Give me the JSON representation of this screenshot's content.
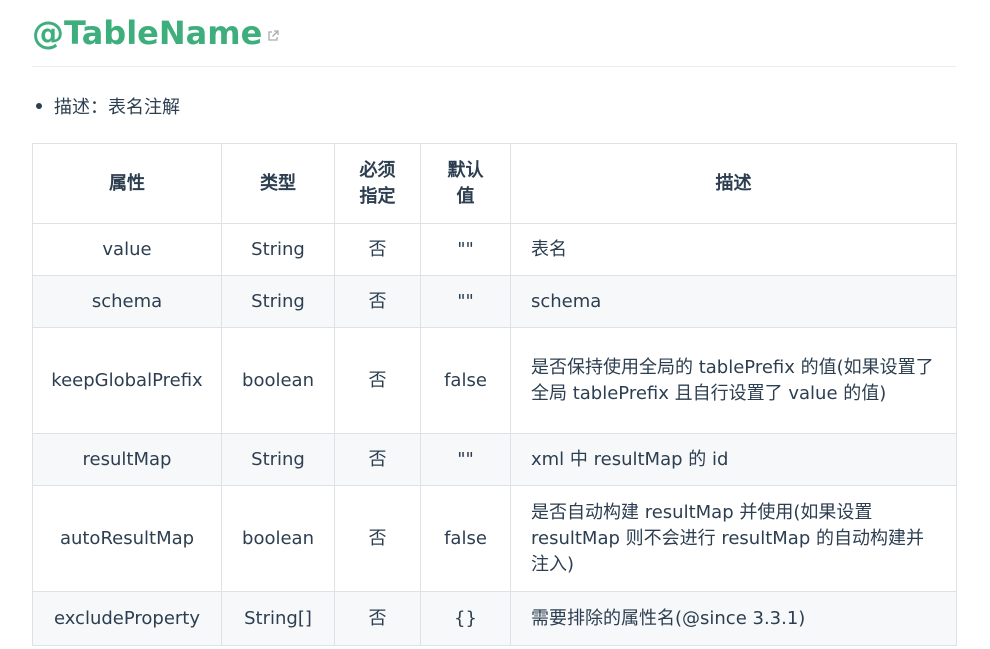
{
  "heading": {
    "title": "@TableName",
    "link_icon": "external-link-icon"
  },
  "description": {
    "text": "描述：表名注解"
  },
  "table": {
    "headers": {
      "attr": "属性",
      "type": "类型",
      "required_line1": "必须",
      "required_line2": "指定",
      "default_line1": "默认",
      "default_line2": "值",
      "desc": "描述"
    },
    "rows": [
      {
        "attr": "value",
        "type": "String",
        "required": "否",
        "default": "\"\"",
        "desc": "表名"
      },
      {
        "attr": "schema",
        "type": "String",
        "required": "否",
        "default": "\"\"",
        "desc": "schema"
      },
      {
        "attr": "keepGlobalPrefix",
        "type": "boolean",
        "required": "否",
        "default": "false",
        "desc": "是否保持使用全局的 tablePrefix 的值(如果设置了全局 tablePrefix 且自行设置了 value 的值)"
      },
      {
        "attr": "resultMap",
        "type": "String",
        "required": "否",
        "default": "\"\"",
        "desc": "xml 中 resultMap 的 id"
      },
      {
        "attr": "autoResultMap",
        "type": "boolean",
        "required": "否",
        "default": "false",
        "desc": "是否自动构建 resultMap 并使用(如果设置 resultMap 则不会进行 resultMap 的自动构建并注入)"
      },
      {
        "attr": "excludeProperty",
        "type": "String[]",
        "required": "否",
        "default": "{}",
        "desc": "需要排除的属性名(@since 3.3.1)"
      }
    ]
  },
  "colors": {
    "heading": "#3eaf7c",
    "text": "#2c3e50",
    "border": "#dfe2e5",
    "stripe": "#f6f8fa"
  }
}
